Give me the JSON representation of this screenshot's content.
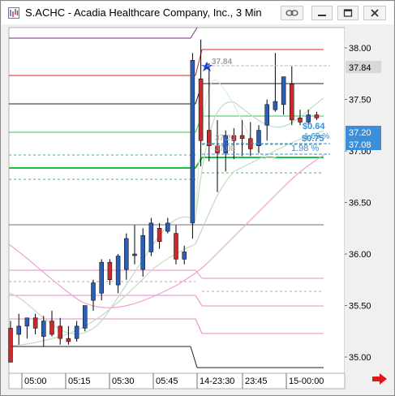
{
  "window": {
    "title": "S.ACHC - Acadia Healthcare Company, Inc., 3 Min"
  },
  "titlebar_buttons": {
    "link": "link-icon",
    "minimize": "minimize-icon",
    "maximize": "maximize-icon",
    "close": "close-icon"
  },
  "chart_data": {
    "type": "candlestick",
    "title": "",
    "x_tick_labels": [
      "05:00",
      "05:15",
      "05:30",
      "05:45",
      "14-23:30",
      "23:45",
      "15-00:00"
    ],
    "y_tick_labels": [
      "38.00",
      "37.50",
      "37.00",
      "36.50",
      "36.00",
      "35.50",
      "35.00"
    ],
    "ylim": [
      34.9,
      38.2
    ],
    "price_badges": [
      {
        "label": "37.84",
        "value": 37.84,
        "color": "#d8d8d8"
      },
      {
        "label": "37.20",
        "value": 37.2,
        "color": "#3a8fd8"
      },
      {
        "label": "37.08",
        "value": 37.08,
        "color": "#3a8fd8"
      }
    ],
    "annotations": [
      {
        "text": "37.84",
        "color": "#a0a0a0"
      },
      {
        "text": "37.20",
        "color": "#a0a0a0"
      },
      {
        "text": "37.08",
        "color": "#a0a0a0"
      },
      {
        "text": "$0.64",
        "color": "#3a8fd8"
      },
      {
        "text": "1.69 %",
        "color": "#3a8fd8"
      },
      {
        "text": "$0.75",
        "color": "#3a8fd8"
      },
      {
        "text": "1.98 %",
        "color": "#3a8fd8"
      }
    ],
    "candles": [
      {
        "o": 35.28,
        "h": 35.35,
        "l": 34.95,
        "c": 34.95
      },
      {
        "o": 35.22,
        "h": 35.42,
        "l": 35.12,
        "c": 35.3
      },
      {
        "o": 35.3,
        "h": 35.38,
        "l": 35.18,
        "c": 35.38
      },
      {
        "o": 35.38,
        "h": 35.42,
        "l": 35.22,
        "c": 35.28
      },
      {
        "o": 35.2,
        "h": 35.4,
        "l": 35.1,
        "c": 35.35
      },
      {
        "o": 35.35,
        "h": 35.45,
        "l": 35.2,
        "c": 35.22
      },
      {
        "o": 35.3,
        "h": 35.38,
        "l": 35.12,
        "c": 35.18
      },
      {
        "o": 35.18,
        "h": 35.3,
        "l": 35.12,
        "c": 35.15
      },
      {
        "o": 35.18,
        "h": 35.35,
        "l": 35.15,
        "c": 35.3
      },
      {
        "o": 35.28,
        "h": 35.5,
        "l": 35.25,
        "c": 35.5
      },
      {
        "o": 35.55,
        "h": 35.75,
        "l": 35.45,
        "c": 35.72
      },
      {
        "o": 35.62,
        "h": 35.95,
        "l": 35.55,
        "c": 35.92
      },
      {
        "o": 35.92,
        "h": 35.95,
        "l": 35.7,
        "c": 35.75
      },
      {
        "o": 35.7,
        "h": 36.0,
        "l": 35.62,
        "c": 35.98
      },
      {
        "o": 35.85,
        "h": 36.2,
        "l": 35.75,
        "c": 36.15
      },
      {
        "o": 36.0,
        "h": 36.28,
        "l": 35.9,
        "c": 36.0
      },
      {
        "o": 35.85,
        "h": 36.25,
        "l": 35.78,
        "c": 36.18
      },
      {
        "o": 36.02,
        "h": 36.35,
        "l": 35.98,
        "c": 36.3
      },
      {
        "o": 36.25,
        "h": 36.3,
        "l": 36.05,
        "c": 36.12
      },
      {
        "o": 36.22,
        "h": 36.35,
        "l": 36.2,
        "c": 36.3
      },
      {
        "o": 36.2,
        "h": 36.28,
        "l": 35.9,
        "c": 35.95
      },
      {
        "o": 35.95,
        "h": 36.08,
        "l": 35.9,
        "c": 36.02
      },
      {
        "o": 36.3,
        "h": 37.95,
        "l": 36.15,
        "c": 37.88
      },
      {
        "o": 37.7,
        "h": 38.08,
        "l": 36.85,
        "c": 37.1
      },
      {
        "o": 37.2,
        "h": 37.85,
        "l": 36.9,
        "c": 37.05
      },
      {
        "o": 37.05,
        "h": 37.3,
        "l": 36.6,
        "c": 36.98
      },
      {
        "o": 36.98,
        "h": 37.2,
        "l": 36.8,
        "c": 37.15
      },
      {
        "o": 37.15,
        "h": 37.22,
        "l": 36.92,
        "c": 37.1
      },
      {
        "o": 37.15,
        "h": 37.3,
        "l": 36.95,
        "c": 37.12
      },
      {
        "o": 37.12,
        "h": 37.28,
        "l": 36.95,
        "c": 37.02
      },
      {
        "o": 37.05,
        "h": 37.25,
        "l": 36.98,
        "c": 37.2
      },
      {
        "o": 37.25,
        "h": 37.5,
        "l": 37.1,
        "c": 37.45
      },
      {
        "o": 37.4,
        "h": 37.95,
        "l": 37.38,
        "c": 37.48
      },
      {
        "o": 37.45,
        "h": 37.72,
        "l": 37.35,
        "c": 37.72
      },
      {
        "o": 37.65,
        "h": 37.82,
        "l": 37.25,
        "c": 37.3
      },
      {
        "o": 37.32,
        "h": 37.4,
        "l": 37.25,
        "c": 37.28
      },
      {
        "o": 37.28,
        "h": 37.4,
        "l": 37.25,
        "c": 37.35
      },
      {
        "o": 37.35,
        "h": 37.38,
        "l": 37.3,
        "c": 37.32
      }
    ],
    "colors": {
      "up": "#2a5fb8",
      "down": "#cc2a2a",
      "bg": "#ffffff"
    }
  }
}
